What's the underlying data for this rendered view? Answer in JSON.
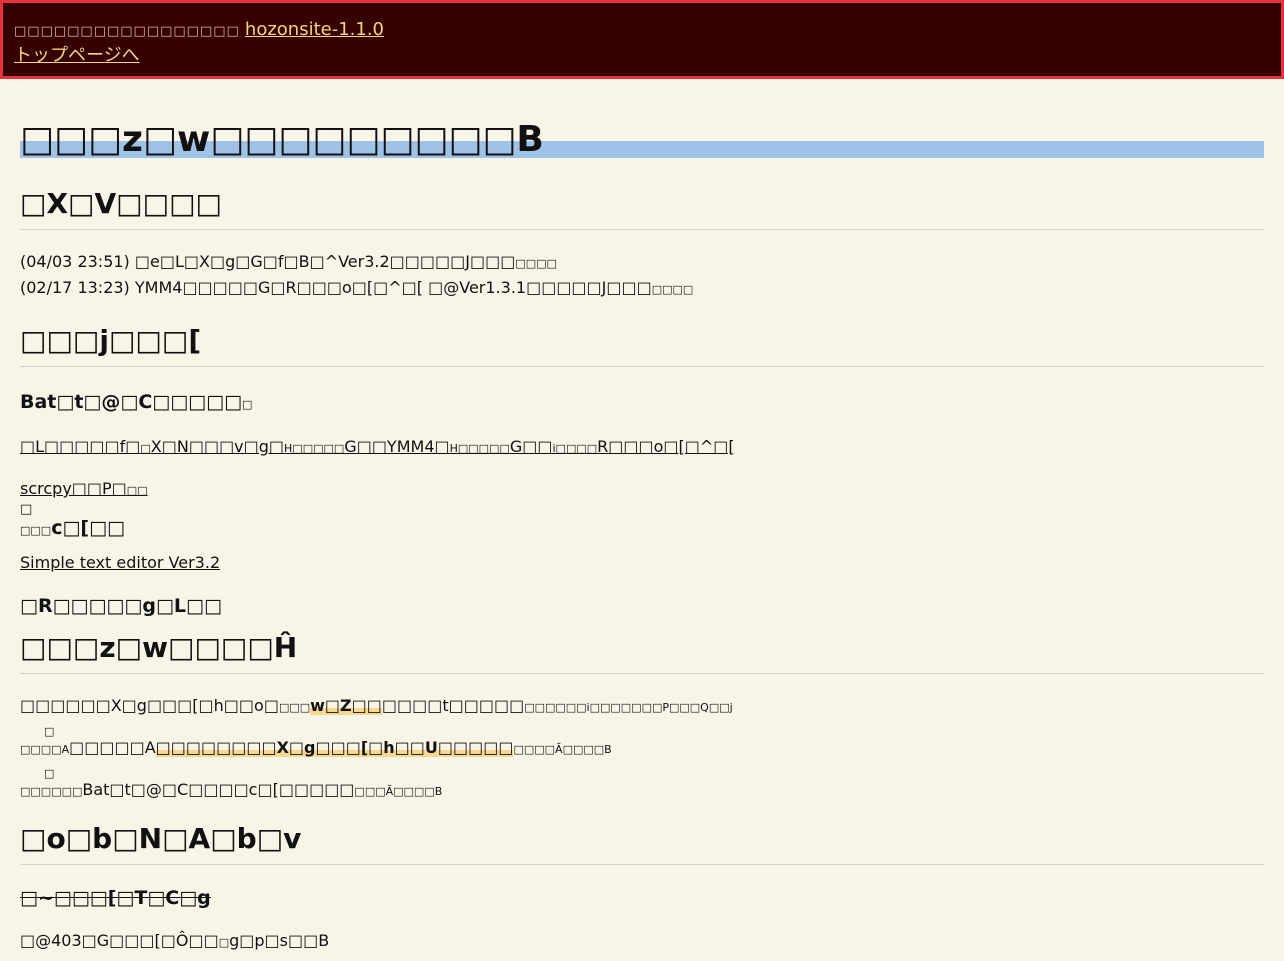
{
  "banner": {
    "notice": "□□□□□□□□□□□□□□□□□",
    "version_link": "hozonsite-1.1.0",
    "top_link": "トップページへ"
  },
  "title": "□□□z□w□□□□□□□□□B",
  "news": {
    "heading": "□X□V□□□□",
    "items": [
      {
        "main": "(04/03 23:51) □e□L□X□g□G□f□B□^Ver3.2□□□□□J□□□",
        "tail": "□□□□"
      },
      {
        "main": "(02/17 13:23) YMM4□□□□□G□R□□□o□[□^□[ □@Ver1.3.1□□□□□J□□□",
        "tail": "□□□□"
      }
    ]
  },
  "menu": {
    "heading": "□□□j□□□[",
    "bat_heading": "Bat□t□@□C□□□□□",
    "bat_heading_tail": "□",
    "link1_a": "□L□□□□□f□",
    "link1_small1": "□",
    "link1_b": "X□N□□□v□g□",
    "link1_small2": "H□□□□□",
    "link1_c": "G□□YMM4□",
    "link1_small3": "H□□□□□",
    "link1_d": "G□□",
    "link1_small4": "i□□□□",
    "link1_e": "R□□□o□[□^□[",
    "scrcpy": "scrcpy□□P□",
    "scrcpy_tail": "□□",
    "mark": "□",
    "tool_heading_small": "□□□",
    "tool_heading": "c□[□□",
    "editor_link": "Simple text editor Ver3.2",
    "contact_heading": "□R□□□□□g□L□□"
  },
  "about": {
    "heading": "□□□z□w□□□□Ĥ",
    "line1_a": "□□□□□□X□g□□□[□h□□o□",
    "line1_small1": "□□□",
    "line1_hl": "w□Z□□",
    "line1_b": "□□□□t□□□□□",
    "line1_small2": "□□□□□□i□",
    "line1_small3": "□□□□□□P□□□Q□□j",
    "line2_small1": "□□□□A",
    "line2_a": "□□□□□A",
    "line2_hl_a": "□□□□□□□□",
    "line2_hl_b": "X□g□□□[□h□□U□□□□□",
    "line2_small2": "□□□□Ă□□",
    "line2_small3": "□□B",
    "mark2": "□",
    "line3_small1": "□□□□□□",
    "line3_a": "Bat□t□@□C□□□□c□[□□□□□",
    "line3_small2": "□□□Ă□□",
    "line3_small3": "□□B",
    "mark3": "□"
  },
  "backup": {
    "heading": "□o□b□N□A□b□v",
    "mirror_heading": "□~□□□[□T□C□g",
    "note": "□@403□G□□□[□Ô□□",
    "note_small": "□",
    "note_tail": "g□p□s□□B"
  }
}
